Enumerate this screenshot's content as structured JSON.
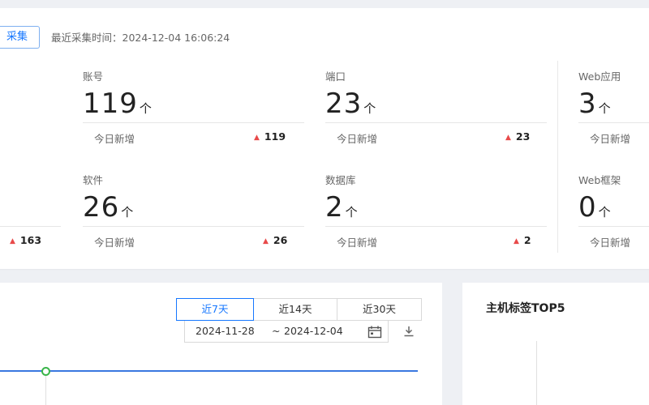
{
  "header": {
    "collect_button": "采集",
    "collect_time": "最近采集时间：2024-12-04 16:06:24"
  },
  "stats": {
    "unit": "个",
    "today_label": "今日新增",
    "hidden_left_delta": "163",
    "items": [
      {
        "title": "账号",
        "value": "119",
        "delta": "119"
      },
      {
        "title": "端口",
        "value": "23",
        "delta": "23"
      },
      {
        "title": "Web应用",
        "value": "3",
        "delta": ""
      },
      {
        "title": "软件",
        "value": "26",
        "delta": "26"
      },
      {
        "title": "数据库",
        "value": "2",
        "delta": "2"
      },
      {
        "title": "Web框架",
        "value": "0",
        "delta": ""
      }
    ]
  },
  "trend": {
    "ranges": [
      "近7天",
      "近14天",
      "近30天"
    ],
    "active_range": "近7天",
    "date_start": "2024-11-28",
    "date_separator": "~",
    "date_end": "2024-12-04"
  },
  "tags": {
    "title": "主机标签TOP5"
  },
  "colors": {
    "accent": "#1677ff",
    "increase": "#e84a4a",
    "line": "#3a78e0",
    "point": "#3ab54a"
  },
  "icons": [
    "calendar-icon",
    "download-icon",
    "triangle-up-icon"
  ]
}
